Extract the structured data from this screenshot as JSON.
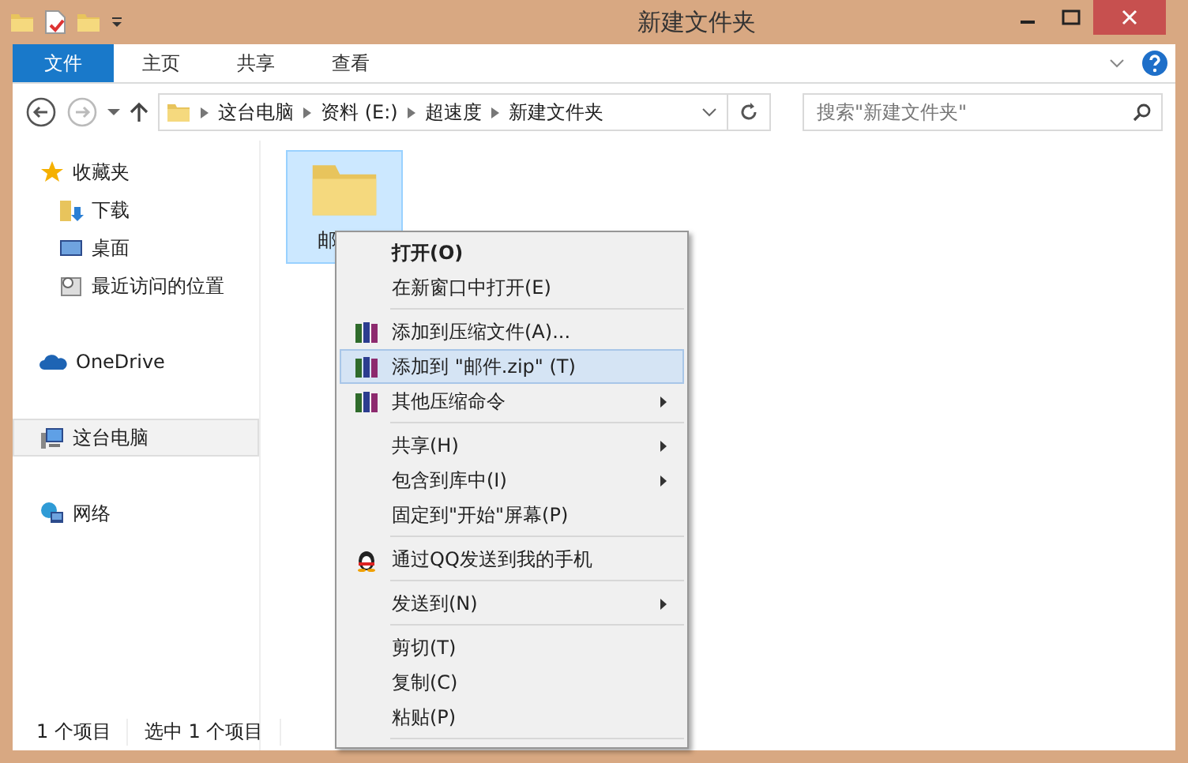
{
  "window": {
    "title": "新建文件夹"
  },
  "ribbon_tabs": [
    {
      "label": "文件",
      "selected": true
    },
    {
      "label": "主页",
      "selected": false
    },
    {
      "label": "共享",
      "selected": false
    },
    {
      "label": "查看",
      "selected": false
    }
  ],
  "address": {
    "crumbs": [
      "这台电脑",
      "资料 (E:)",
      "超速度",
      "新建文件夹"
    ]
  },
  "search": {
    "placeholder": "搜索\"新建文件夹\""
  },
  "sidebar": {
    "groups": [
      {
        "label": "收藏夹",
        "selected": false,
        "children": [
          {
            "label": "下载",
            "selected": false
          },
          {
            "label": "桌面",
            "selected": false
          },
          {
            "label": "最近访问的位置",
            "selected": false
          }
        ]
      },
      {
        "label": "OneDrive",
        "selected": false
      },
      {
        "label": "这台电脑",
        "selected": true
      },
      {
        "label": "网络",
        "selected": false
      }
    ]
  },
  "files": [
    {
      "name": "邮",
      "selected": true
    }
  ],
  "context_menu": [
    {
      "kind": "plain",
      "label": "打开(O)",
      "bold": true,
      "submenu": false,
      "selected": false
    },
    {
      "kind": "plain",
      "label": "在新窗口中打开(E)",
      "bold": false,
      "submenu": false,
      "selected": false
    },
    {
      "kind": "separator"
    },
    {
      "kind": "archive",
      "label": "添加到压缩文件(A)...",
      "bold": false,
      "submenu": false,
      "selected": false
    },
    {
      "kind": "archive",
      "label": "添加到 \"邮件.zip\" (T)",
      "bold": false,
      "submenu": false,
      "selected": true
    },
    {
      "kind": "archive",
      "label": "其他压缩命令",
      "bold": false,
      "submenu": true,
      "selected": false
    },
    {
      "kind": "separator"
    },
    {
      "kind": "plain",
      "label": "共享(H)",
      "bold": false,
      "submenu": true,
      "selected": false
    },
    {
      "kind": "plain",
      "label": "包含到库中(I)",
      "bold": false,
      "submenu": true,
      "selected": false
    },
    {
      "kind": "plain",
      "label": "固定到\"开始\"屏幕(P)",
      "bold": false,
      "submenu": false,
      "selected": false
    },
    {
      "kind": "separator"
    },
    {
      "kind": "qq",
      "label": "通过QQ发送到我的手机",
      "bold": false,
      "submenu": false,
      "selected": false
    },
    {
      "kind": "separator"
    },
    {
      "kind": "plain",
      "label": "发送到(N)",
      "bold": false,
      "submenu": true,
      "selected": false
    },
    {
      "kind": "separator"
    },
    {
      "kind": "plain",
      "label": "剪切(T)",
      "bold": false,
      "submenu": false,
      "selected": false
    },
    {
      "kind": "plain",
      "label": "复制(C)",
      "bold": false,
      "submenu": false,
      "selected": false
    },
    {
      "kind": "plain",
      "label": "粘贴(P)",
      "bold": false,
      "submenu": false,
      "selected": false
    },
    {
      "kind": "separator"
    }
  ],
  "status_bar": [
    "1 个项目",
    "选中 1 个项目"
  ]
}
